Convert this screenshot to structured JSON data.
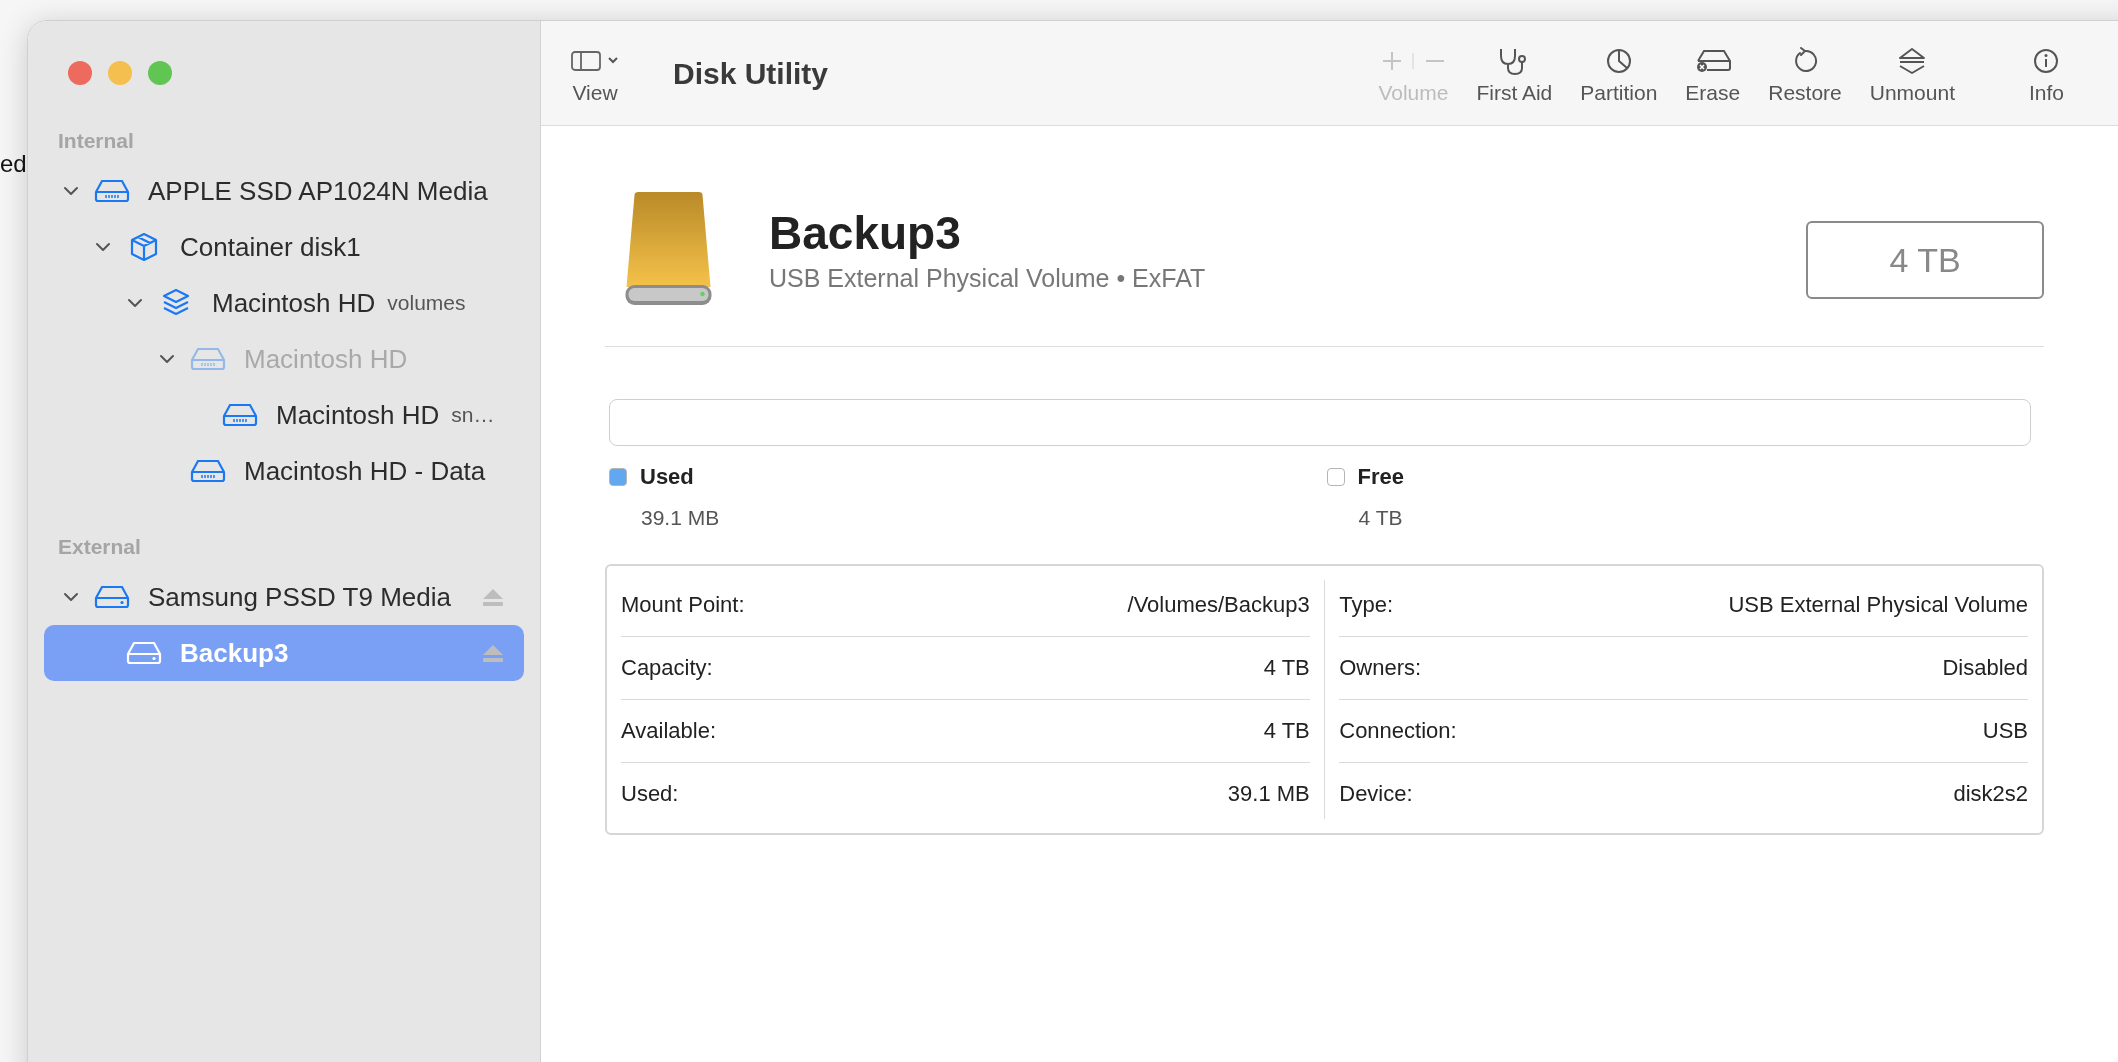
{
  "background_text": "ed",
  "window": {
    "title": "Disk Utility"
  },
  "toolbar": {
    "view": {
      "label": "View"
    },
    "items": [
      {
        "label": "Volume",
        "kind": "volume",
        "disabled": true
      },
      {
        "label": "First Aid",
        "kind": "stethoscope",
        "disabled": false
      },
      {
        "label": "Partition",
        "kind": "pie",
        "disabled": false
      },
      {
        "label": "Erase",
        "kind": "erase",
        "disabled": false
      },
      {
        "label": "Restore",
        "kind": "restore",
        "disabled": false
      },
      {
        "label": "Unmount",
        "kind": "unmount",
        "disabled": false
      }
    ],
    "info": {
      "label": "Info"
    }
  },
  "sidebar": {
    "sections": [
      {
        "title": "Internal",
        "items": [
          {
            "label": "APPLE SSD AP1024N Media",
            "kind": "drive",
            "expanded": true,
            "selected": false,
            "disabled": false,
            "ejectable": false,
            "children": [
              {
                "label": "Container disk1",
                "kind": "container",
                "expanded": true,
                "selected": false,
                "disabled": false,
                "ejectable": false,
                "children": [
                  {
                    "label": "Macintosh HD",
                    "detail": "volumes",
                    "kind": "volumes",
                    "expanded": true,
                    "selected": false,
                    "disabled": false,
                    "ejectable": false,
                    "children": [
                      {
                        "label": "Macintosh HD",
                        "kind": "drive",
                        "expanded": true,
                        "selected": false,
                        "disabled": true,
                        "ejectable": false,
                        "children": [
                          {
                            "label": "Macintosh HD",
                            "detail": "sn…",
                            "kind": "drive",
                            "selected": false,
                            "disabled": false,
                            "ejectable": false
                          }
                        ]
                      },
                      {
                        "label": "Macintosh HD - Data",
                        "kind": "drive",
                        "selected": false,
                        "disabled": false,
                        "ejectable": false
                      }
                    ]
                  }
                ]
              }
            ]
          }
        ]
      },
      {
        "title": "External",
        "items": [
          {
            "label": "Samsung PSSD T9 Media",
            "kind": "external",
            "expanded": true,
            "selected": false,
            "disabled": false,
            "ejectable": true,
            "children": [
              {
                "label": "Backup3",
                "kind": "external",
                "selected": true,
                "disabled": false,
                "ejectable": true
              }
            ]
          }
        ]
      }
    ]
  },
  "volume": {
    "name": "Backup3",
    "subtitle": "USB External Physical Volume • ExFAT",
    "size": "4 TB",
    "usage": {
      "legend": [
        {
          "label": "Used",
          "value": "39.1 MB",
          "color": "#62a8f0"
        },
        {
          "label": "Free",
          "value": "4 TB",
          "color": "#ffffff"
        }
      ]
    },
    "details_left": [
      {
        "label": "Mount Point:",
        "value": "/Volumes/Backup3"
      },
      {
        "label": "Capacity:",
        "value": "4 TB"
      },
      {
        "label": "Available:",
        "value": "4 TB"
      },
      {
        "label": "Used:",
        "value": "39.1 MB"
      }
    ],
    "details_right": [
      {
        "label": "Type:",
        "value": "USB External Physical Volume"
      },
      {
        "label": "Owners:",
        "value": "Disabled"
      },
      {
        "label": "Connection:",
        "value": "USB"
      },
      {
        "label": "Device:",
        "value": "disk2s2"
      }
    ]
  }
}
